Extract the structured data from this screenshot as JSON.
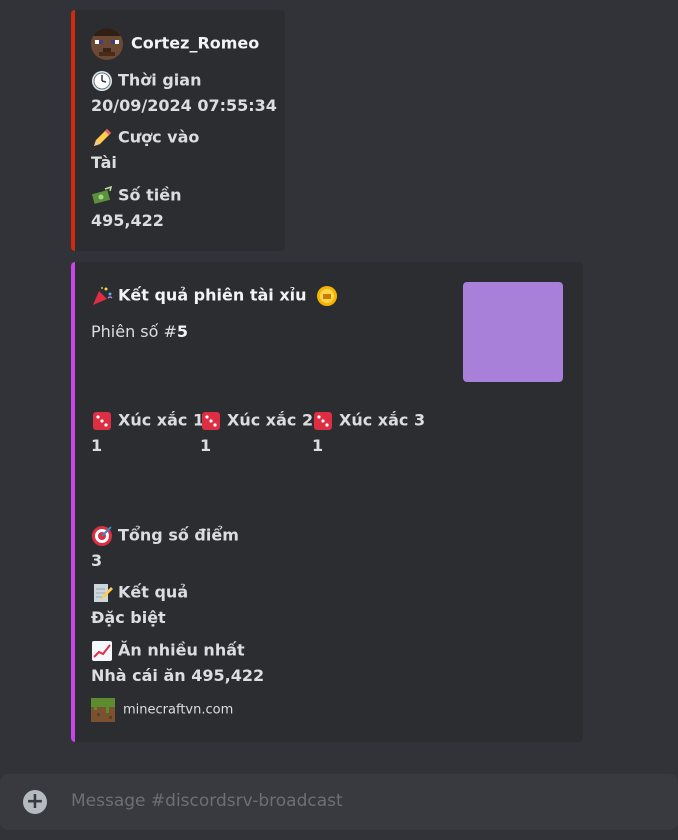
{
  "colors": {
    "embed1_bar": "#d12b0f",
    "embed2_bar": "#c846e8",
    "thumbnail": "#a87fd9"
  },
  "embed1": {
    "author": "Cortez_Romeo",
    "fields": [
      {
        "icon": "clock-icon",
        "name": "Thời gian",
        "value": "20/09/2024 07:55:34"
      },
      {
        "icon": "pencil-icon",
        "name": "Cược vào",
        "value": "Tài"
      },
      {
        "icon": "money-icon",
        "name": "Số tiền",
        "value": "495,422"
      }
    ]
  },
  "embed2": {
    "title": "Kết quả phiên tài xỉu",
    "description_prefix": "Phiên số #",
    "session_number": "5",
    "dice": [
      {
        "icon": "dice-icon",
        "name": "Xúc xắc 1",
        "value": "1"
      },
      {
        "icon": "dice-icon",
        "name": "Xúc xắc 2",
        "value": "1"
      },
      {
        "icon": "dice-icon",
        "name": "Xúc xắc 3",
        "value": "1"
      }
    ],
    "fields": [
      {
        "icon": "target-icon",
        "name": "Tổng số điểm",
        "value": "3"
      },
      {
        "icon": "memo-icon",
        "name": "Kết quả",
        "value": "Đặc biệt"
      },
      {
        "icon": "chart-up-icon",
        "name": "Ăn nhiều nhất",
        "value": "Nhà cái ăn 495,422"
      }
    ],
    "footer": "minecraftvn.com"
  },
  "composer": {
    "placeholder": "Message #discordsrv-broadcast"
  }
}
